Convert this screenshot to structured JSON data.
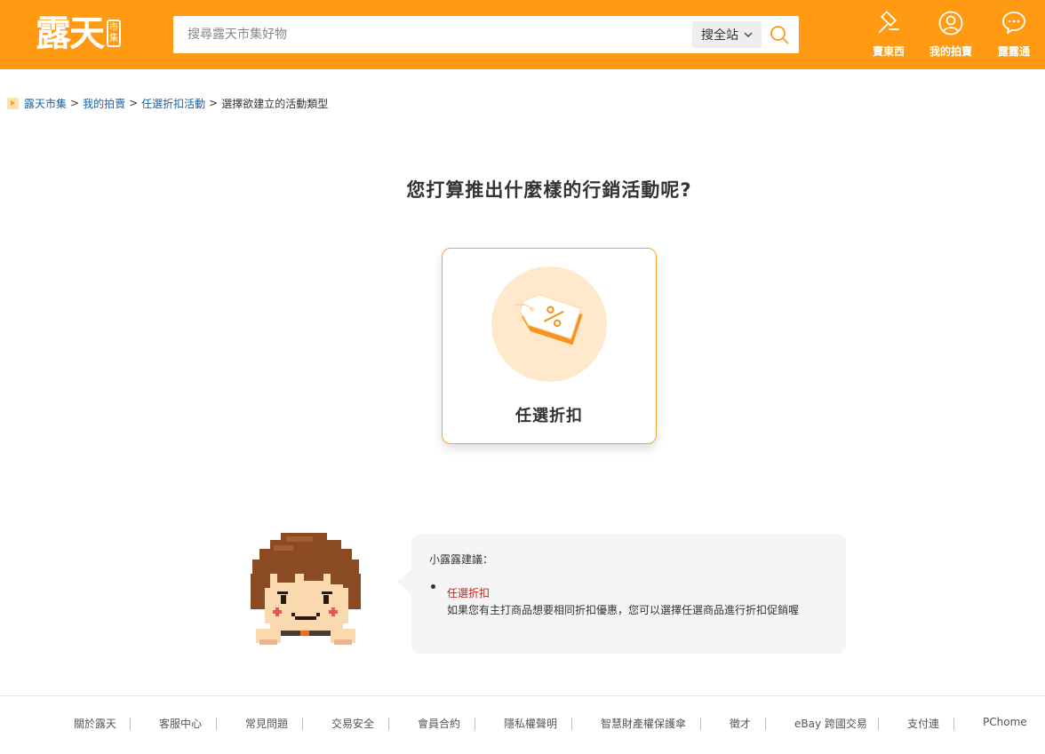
{
  "header": {
    "logo_text": "露天",
    "logo_badge": "市集",
    "search": {
      "placeholder": "搜尋露天市集好物",
      "scope_label": "搜全站"
    },
    "nav": [
      {
        "label": "賣東西",
        "icon": "gavel-icon"
      },
      {
        "label": "我的拍賣",
        "icon": "user-icon"
      },
      {
        "label": "露露通",
        "icon": "chat-icon"
      }
    ],
    "brand_color": "#ff9a12"
  },
  "breadcrumb": {
    "items": [
      "露天市集",
      "我的拍賣",
      "任選折扣活動"
    ],
    "current": "選擇欲建立的活動類型",
    "separator": ">"
  },
  "main": {
    "question": "您打算推出什麼樣的行銷活動呢?",
    "card": {
      "label": "任選折扣",
      "icon": "discount-tag-icon",
      "border_color": "#f8a436"
    }
  },
  "tip": {
    "title": "小露露建議：",
    "item_name": "任選折扣",
    "item_desc": "如果您有主打商品想要相同折扣優惠，您可以選擇任選商品進行折扣促銷喔"
  },
  "footer": {
    "links": [
      "關於露天",
      "客服中心",
      "常見問題",
      "交易安全",
      "會員合約",
      "隱私權聲明",
      "智慧財產權保護傘",
      "徵才",
      "eBay 跨國交易",
      "支付連",
      "PChome"
    ]
  }
}
